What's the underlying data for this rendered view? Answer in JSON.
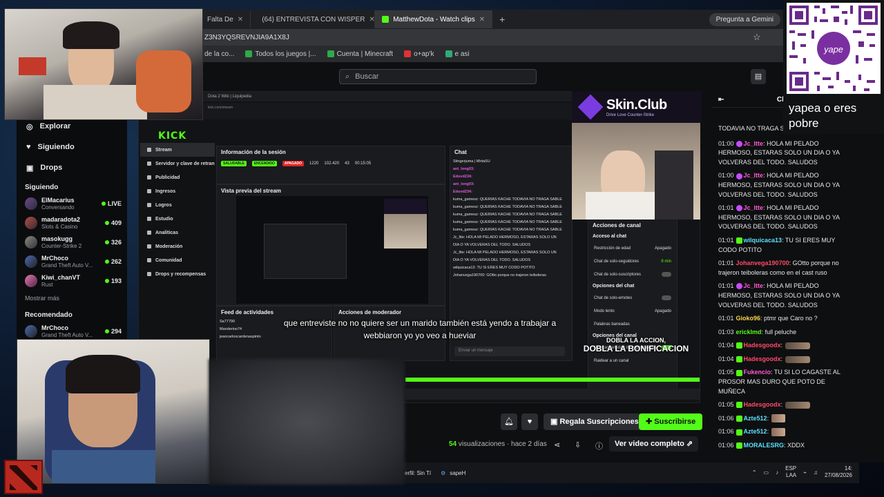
{
  "browser": {
    "tabs": [
      {
        "label": "Falta De",
        "active": false
      },
      {
        "label": "(64) ENTREVISTA CON WISPER",
        "active": false
      },
      {
        "label": "MatthewDota - Watch clips",
        "active": true
      }
    ],
    "gemini_label": "Pregunta a Gemini",
    "url": "Z3N3YQSREVNJIA9A1X8J",
    "bookmarks": [
      "de la co...",
      "Todos los juegos |...",
      "Cuenta | Minecraft",
      "o+ap'k",
      "e asi"
    ]
  },
  "kick": {
    "search_placeholder": "Buscar",
    "sidebar": {
      "nav": [
        {
          "label": "Explorar",
          "icon": "compass-icon"
        },
        {
          "label": "Siguiendo",
          "icon": "heart-icon"
        },
        {
          "label": "Drops",
          "icon": "gift-icon"
        }
      ],
      "following_title": "Siguiendo",
      "following": [
        {
          "name": "ElMacarius",
          "game": "Conversando",
          "count": "LIVE"
        },
        {
          "name": "madaradota2",
          "game": "Slots & Casino",
          "count": "409"
        },
        {
          "name": "masokugg",
          "game": "Counter-Strike 2",
          "count": "326"
        },
        {
          "name": "MrChoco",
          "game": "Grand Theft Auto V...",
          "count": "262"
        },
        {
          "name": "Kiwi_chanVT",
          "game": "Rust",
          "count": "193"
        }
      ],
      "show_more": "Mostrar más",
      "recommended_title": "Recomendado",
      "recommended": [
        {
          "name": "MrChoco",
          "game": "Grand Theft Auto V...",
          "count": "294"
        }
      ]
    },
    "below_video": {
      "gift_label": "Regala Suscripciones",
      "subscribe_label": "Suscribirse",
      "views_count": "54",
      "views_text": "visualizaciones",
      "time_ago": "· hace 2 días",
      "full_video_label": "Ver video completo"
    },
    "chat": {
      "header": "Chat",
      "top_line": "TODAVIA NO TRAGA S",
      "messages": [
        {
          "time": "01:00",
          "user": "Jc_ltte",
          "text": ": HOLA MI PELADO HERMOSO, ESTARAS SOLO UN DIA O YA VOLVERAS DEL TODO. SALUDOS",
          "color": "pink",
          "badge": "sub"
        },
        {
          "time": "01:00",
          "user": "Jc_ltte",
          "text": ": HOLA MI PELADO HERMOSO, ESTARAS SOLO UN DIA O YA VOLVERAS DEL TODO. SALUDOS",
          "color": "pink",
          "badge": "sub"
        },
        {
          "time": "01:01",
          "user": "Jc_ltte",
          "text": ": HOLA MI PELADO HERMOSO, ESTARAS SOLO UN DIA O YA VOLVERAS DEL TODO. SALUDOS",
          "color": "pink",
          "badge": "sub"
        },
        {
          "time": "01:01",
          "user": "wilquicaca13",
          "text": ": TU SI ERES MUY CODO POTITO",
          "color": "cyan",
          "badge": "mod"
        },
        {
          "time": "01:01",
          "user": "Johanvega190700",
          "text": ": GOtto porque no trajeron teiboleras como en el cast ruso",
          "color": "red",
          "badge": "none"
        },
        {
          "time": "01:01",
          "user": "Jc_ltte",
          "text": ": HOLA MI PELADO HERMOSO, ESTARAS SOLO UN DIA O YA VOLVERAS DEL TODO. SALUDOS",
          "color": "pink",
          "badge": "sub"
        },
        {
          "time": "01:01",
          "user": "Gioko96",
          "text": ": ptmr que Caro no ?",
          "color": "yellow",
          "badge": "none"
        },
        {
          "time": "01:03",
          "user": "erickImd",
          "text": ": full peluche",
          "color": "green",
          "badge": "none"
        },
        {
          "time": "01:04",
          "user": "Hadesgoodx",
          "text": ":",
          "color": "red",
          "badge": "mod"
        },
        {
          "time": "01:04",
          "user": "Hadesgoodx",
          "text": ":",
          "color": "red",
          "badge": "mod"
        },
        {
          "time": "01:05",
          "user": "Fukencio",
          "text": ": TU SI LO CAGASTE AL PROSOR MAS DURO QUE POTO DE MUÑECA",
          "color": "pink",
          "badge": "mod"
        },
        {
          "time": "01:05",
          "user": "Hadesgoodx",
          "text": ":",
          "color": "red",
          "badge": "mod"
        },
        {
          "time": "01:06",
          "user": "Azte512",
          "text": ":",
          "color": "cyan",
          "badge": "mod"
        },
        {
          "time": "01:06",
          "user": "Azte512",
          "text": ":",
          "color": "cyan",
          "badge": "mod"
        },
        {
          "time": "01:06",
          "user": "MORALESRG",
          "text": ": XDDX",
          "color": "cyan",
          "badge": "mod"
        }
      ]
    }
  },
  "inner_video": {
    "tab_label": "Dota 2 Wiki | Liquipedia",
    "url": "kick.com/stream",
    "kick_logo": "KICK",
    "dash_nav": [
      "Stream",
      "Servidor y clave de retran",
      "Publicidad",
      "Ingresos",
      "Logros",
      "Estudio",
      "Analíticas",
      "Moderación",
      "Comunidad",
      "Drops y recompensas"
    ],
    "session_title": "Información de la sesión",
    "session_badges": [
      "SALUDABLE",
      "ENCENDIDO",
      "APAGADO"
    ],
    "session_stats": [
      "1220",
      "102.420",
      "43",
      "00:15:05"
    ],
    "session_labels": [
      "Sesión",
      "Ingreso de",
      "Multistream",
      "Espectadores",
      "Seguidores",
      "Cantidad de",
      "Tiempo"
    ],
    "preview_title": "Vista previa del stream",
    "chat_title": "Chat",
    "chat_lines": [
      "Stingerjuma | MirtaSU",
      "ant_long03:",
      "Eduvd234:",
      "ant_long03:",
      "Eduvd234:",
      "kuma_gamesz: QUERIAS KACHE TODAVIA NO TRAGA SABLE",
      "kuma_gamesz: QUERIAS KACHE TODAVIA NO TRAGA SABLE",
      "kuma_gamesz: QUERIAS KACHE TODAVIA NO TRAGA SABLE",
      "kuma_gamesz: QUERIAS KACHE TODAVIA NO TRAGA SABLE",
      "kuma_gamesz: QUERIAS KACHE TODAVIA NO TRAGA SABLE",
      "Jc_ltte: HOLA MI PELADO HERMOSO, ESTARAS SOLO UN",
      "DIA O YA VOLVERAS DEL TODO. SALUDOS",
      "Jc_ltte: HOLA MI PELADO HERMOSO, ESTARAS SOLO UN",
      "DIA O YA VOLVERAS DEL TODO. SALUDOS",
      "wilquicaca13: TU SI ERES MUY CODO POTITO",
      "Johanvega190700: GOtto porque no trajeron teiboleras"
    ],
    "mod_title": "Acciones de canal",
    "mod_section": "Acceso al chat",
    "mod_rows": [
      {
        "label": "Restricción de edad",
        "value": "Apagado"
      },
      {
        "label": "Chat de solo-seguidores",
        "value": "8 min"
      },
      {
        "label": "Chat de solo-suscriptores",
        "value": ""
      }
    ],
    "mod_section2": "Opciones del chat",
    "mod_rows2": [
      {
        "label": "Chat de solo-emotes",
        "value": ""
      },
      {
        "label": "Modo lento",
        "value": "Apagado"
      },
      {
        "label": "Palabras baneadas",
        "value": ""
      }
    ],
    "mod_section3": "Opciones del canal",
    "mod_rows3": [
      {
        "label": "Mostrar cantidad de espectadores",
        "value": ""
      },
      {
        "label": "Raidear a un canal",
        "value": ""
      }
    ],
    "activity_title": "Feed de actividades",
    "activity_items": [
      "Sa77790",
      "Manderino74",
      "jeancarloscardenaspinto"
    ],
    "mod_actions_title": "Acciones de moderador",
    "chat_input_placeholder": "Enviar un mensaje"
  },
  "overlay": {
    "skin_club": "Skin.Club",
    "skin_sub": "Drive Love Counter-Strike",
    "subtitle_line1": "que entreviste no no quiere ser un marido también está yendo a trabajar a",
    "subtitle_line2": "webbiaron yo yo veo a hueviar",
    "dobla_small": "DOBLA LA ACCION,",
    "dobla_big": "DOBLA LA BONIFICACION",
    "qr_text_line1": "yapea o eres",
    "qr_text_line2": "pobre",
    "qr_brand": "yape"
  },
  "taskbar": {
    "items": [
      "erfil: Sin Tí",
      "sapeH"
    ],
    "lang1": "ESP",
    "lang2": "LAA",
    "time": "14:",
    "date": "27/08/2026"
  },
  "colors": {
    "kick_green": "#53fc18",
    "bg": "#0e0f11"
  }
}
